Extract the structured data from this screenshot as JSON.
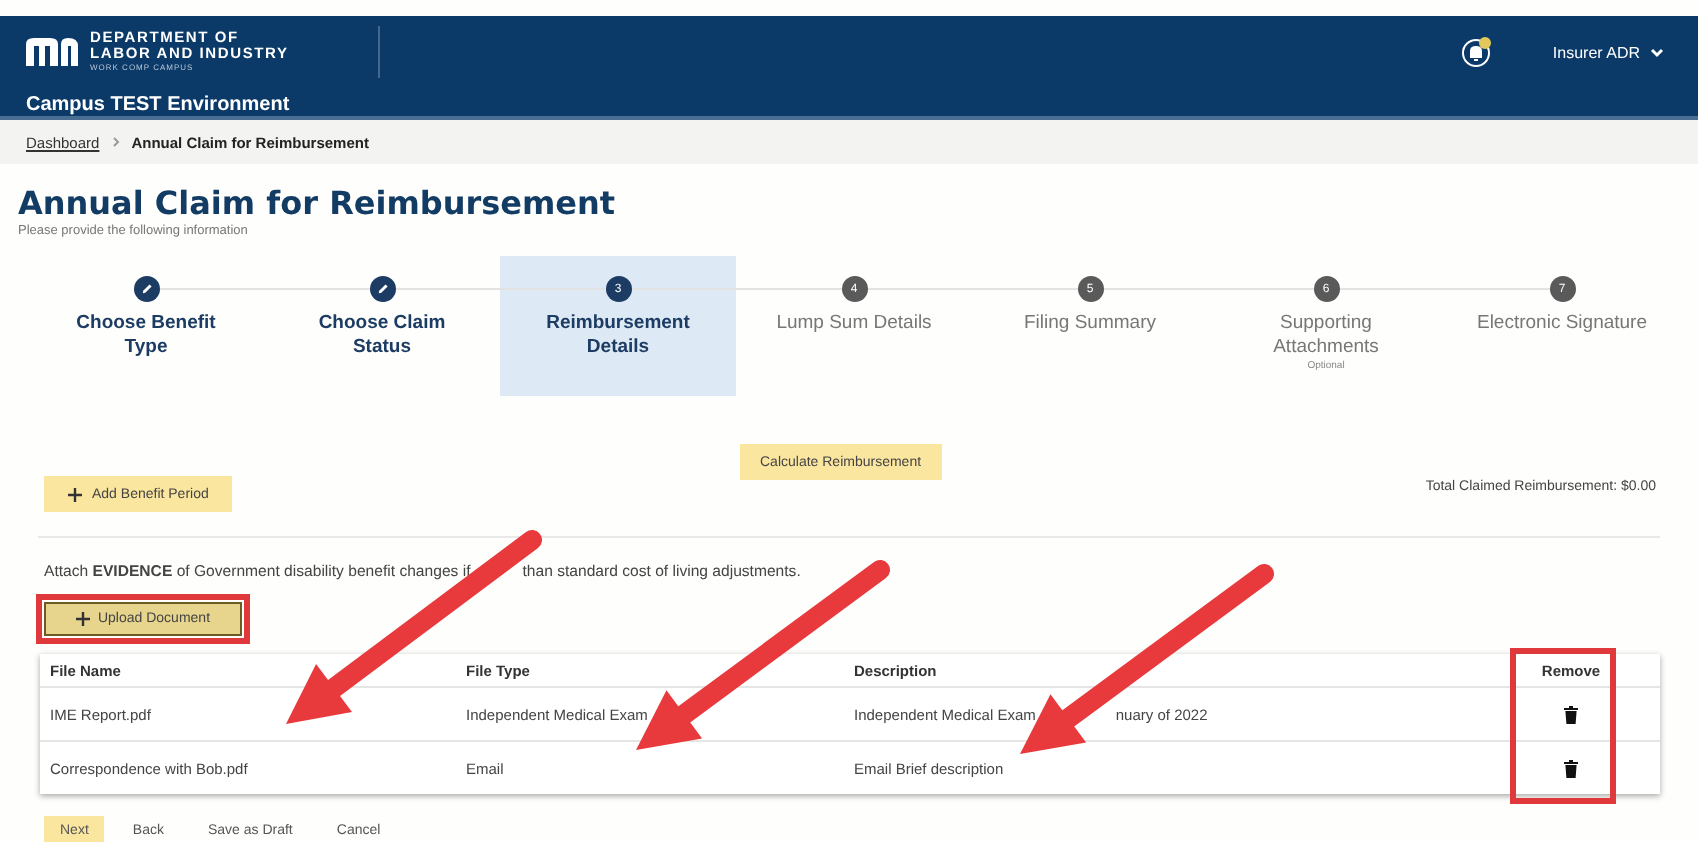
{
  "header": {
    "logo_lines": [
      "DEPARTMENT OF",
      "LABOR AND INDUSTRY"
    ],
    "logo_subtitle": "WORK COMP CAMPUS",
    "environment": "Campus TEST Environment",
    "notifications": {
      "unread": true
    },
    "user": "Insurer ADR"
  },
  "breadcrumb": [
    {
      "label": "Dashboard",
      "link": true
    },
    {
      "label": "Annual Claim for Reimbursement",
      "link": false
    }
  ],
  "page": {
    "title": "Annual Claim for Reimbursement",
    "subtitle": "Please provide the following information"
  },
  "steps": [
    {
      "label": "Choose Benefit Type",
      "completed": true,
      "selected": false
    },
    {
      "label": "Choose Claim Status",
      "completed": true,
      "selected": false
    },
    {
      "number": "3",
      "label": "Reimbursement Details",
      "completed": false,
      "selected": true
    },
    {
      "number": "4",
      "label": "Lump Sum Details",
      "completed": false,
      "selected": false
    },
    {
      "number": "5",
      "label": "Filing Summary",
      "completed": false,
      "selected": false
    },
    {
      "number": "6",
      "label": "Supporting Attachments",
      "note": "Optional",
      "completed": false,
      "selected": false
    },
    {
      "number": "7",
      "label": "Electronic Signature",
      "completed": false,
      "selected": false
    }
  ],
  "calculate_button": "Calculate Reimbursement",
  "total": "Total Claimed Reimbursement: $0.00",
  "add_period_button": "Add Benefit Period",
  "evidence": {
    "parts": [
      "Attach **EVIDENCE** of Government disability benefit changes if",
      "than standard cost of living adjustments."
    ],
    "upload_button": "Upload Document",
    "highlighted": true
  },
  "table": {
    "columns": [
      "File Name",
      "File Type",
      "Description",
      "Remove"
    ],
    "remove_highlighted": true,
    "rows": [
      {
        "file_name": "IME Report.pdf",
        "file_type": "Independent Medical Exam",
        "description": [
          "Independent Medical Exam",
          "nuary of 2022"
        ]
      },
      {
        "file_name": "Correspondence with Bob.pdf",
        "file_type": "Email",
        "description": [
          "Email Brief description"
        ]
      }
    ]
  },
  "footer_buttons": [
    {
      "label": "Next",
      "kind": "primary"
    },
    {
      "label": "Back",
      "kind": "plain"
    },
    {
      "label": "Save as Draft",
      "kind": "plain"
    },
    {
      "label": "Cancel",
      "kind": "plain"
    }
  ]
}
